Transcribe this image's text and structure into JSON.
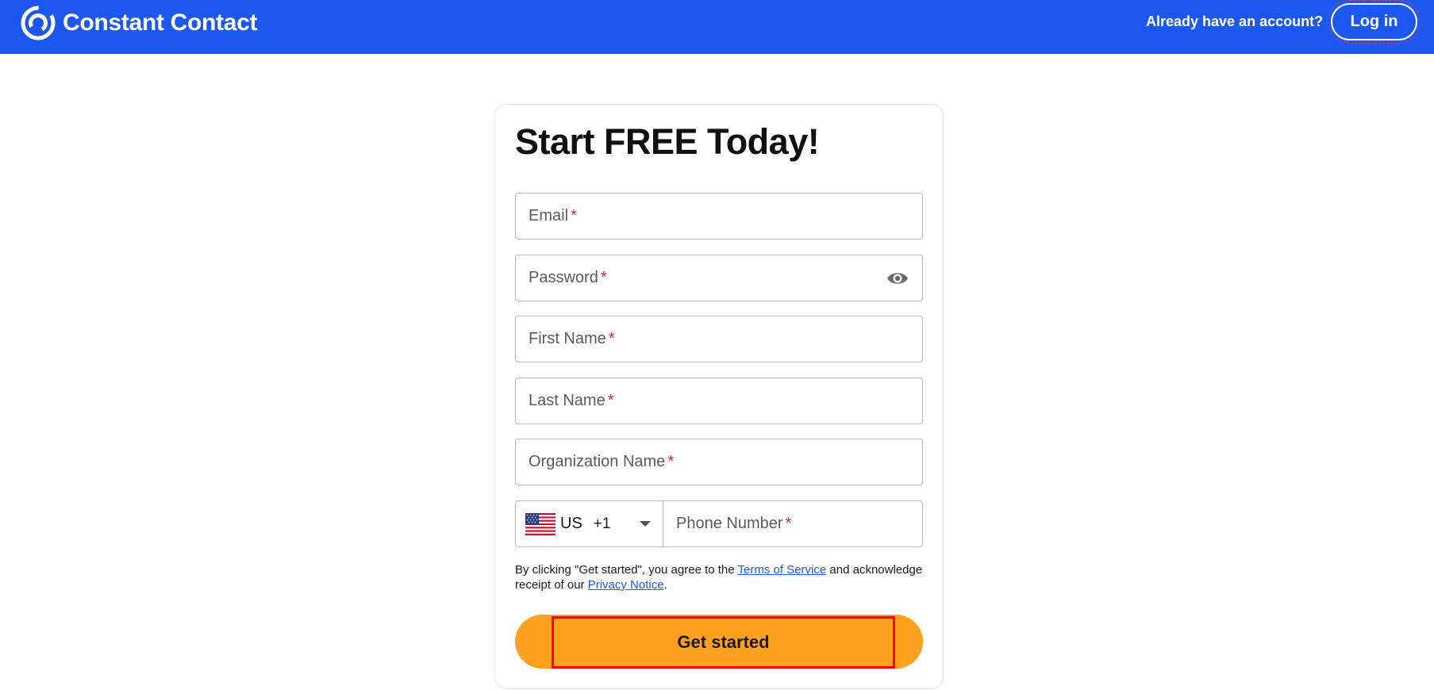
{
  "header": {
    "brand": "Constant Contact",
    "account_question": "Already have an account?",
    "login_label": "Log in",
    "brand_color": "#1c58f0"
  },
  "form": {
    "title": "Start FREE Today!",
    "fields": {
      "email": "Email",
      "password": "Password",
      "first_name": "First Name",
      "last_name": "Last Name",
      "organization": "Organization Name",
      "phone": "Phone Number"
    },
    "required_mark": "*",
    "country": {
      "code": "US",
      "dial": "+1",
      "flag_icon": "us-flag-icon"
    },
    "legal": {
      "prefix": "By clicking \"Get started\", you agree to the ",
      "terms_link": "Terms of Service",
      "middle": " and acknowledge receipt of our ",
      "privacy_link": "Privacy Notice",
      "suffix": "."
    },
    "submit_label": "Get started",
    "submit_color": "#ffa01e"
  }
}
